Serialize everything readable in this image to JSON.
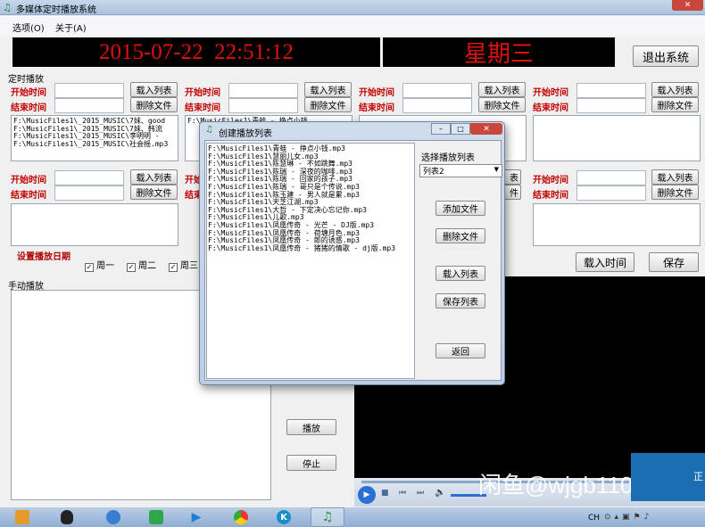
{
  "window": {
    "title": "多媒体定时播放系统"
  },
  "menu": [
    "选项(O)",
    "关于(A)"
  ],
  "clock": {
    "datetime": "2015-07-22  22:51:12",
    "weekday": "星期三"
  },
  "exit_label": "退出系统",
  "timed_section": "定时播放",
  "labels": {
    "start": "开始时间",
    "end": "结束时间",
    "load_list": "载入列表",
    "delete_file": "删除文件"
  },
  "slot1_files": [
    "F:\\MusicFiles1\\_2015_MUSIC\\7妹、good",
    "F:\\MusicFiles1\\_2015_MUSIC\\7妹、韩流",
    "F:\\MusicFiles1\\_2015_MUSIC\\李明明 - ",
    "F:\\MusicFiles1\\_2015_MUSIC\\社会摇.mp3"
  ],
  "slot2_partial": "F:\\MusicFiles1\\青蛙 - 挣点小钱",
  "date_section": {
    "title": "设置播放日期",
    "days": [
      "周一",
      "周二",
      "周三"
    ]
  },
  "load_time_label": "载入时间",
  "save_label": "保存",
  "manual_section": "手动播放",
  "play_label": "播放",
  "stop_label": "停止",
  "watermark": "闲鱼@wjgb1109",
  "corner_text": "正",
  "tray_text": "CH",
  "dialog": {
    "title": "创建播放列表",
    "select_label": "选择播放列表",
    "selected": "列表2",
    "add_file": "添加文件",
    "delete_file": "删除文件",
    "load_list": "载入列表",
    "save_list": "保存列表",
    "back": "返回",
    "files": [
      "F:\\MusicFiles1\\青蛙 - 挣点小钱.mp3",
      "F:\\MusicFiles1\\慧丽儿女.mp3",
      "F:\\MusicFiles1\\陈慧琳 - 不如跳舞.mp3",
      "F:\\MusicFiles1\\陈瑞 - 深夜的咖啡.mp3",
      "F:\\MusicFiles1\\陈瑞 - 回家的孩子.mp3",
      "F:\\MusicFiles1\\陈瑞 - 哥只是个传说.mp3",
      "F:\\MusicFiles1\\陈玉建 - 男人就是累.mp3",
      "F:\\MusicFiles1\\天芝江湖.mp3",
      "F:\\MusicFiles1\\大哲 - 下定决心忘记你.mp3",
      "F:\\MusicFiles1\\儿歌.mp3",
      "F:\\MusicFiles1\\凤凰传奇 - 光芒 - DJ版.mp3",
      "F:\\MusicFiles1\\凤凰传奇 - 荷塘月色.mp3",
      "F:\\MusicFiles1\\凤凰传奇 - 郎的诱惑.mp3",
      "F:\\MusicFiles1\\凤凰传奇 - 猪猪的情歌 - dj版.mp3"
    ]
  }
}
